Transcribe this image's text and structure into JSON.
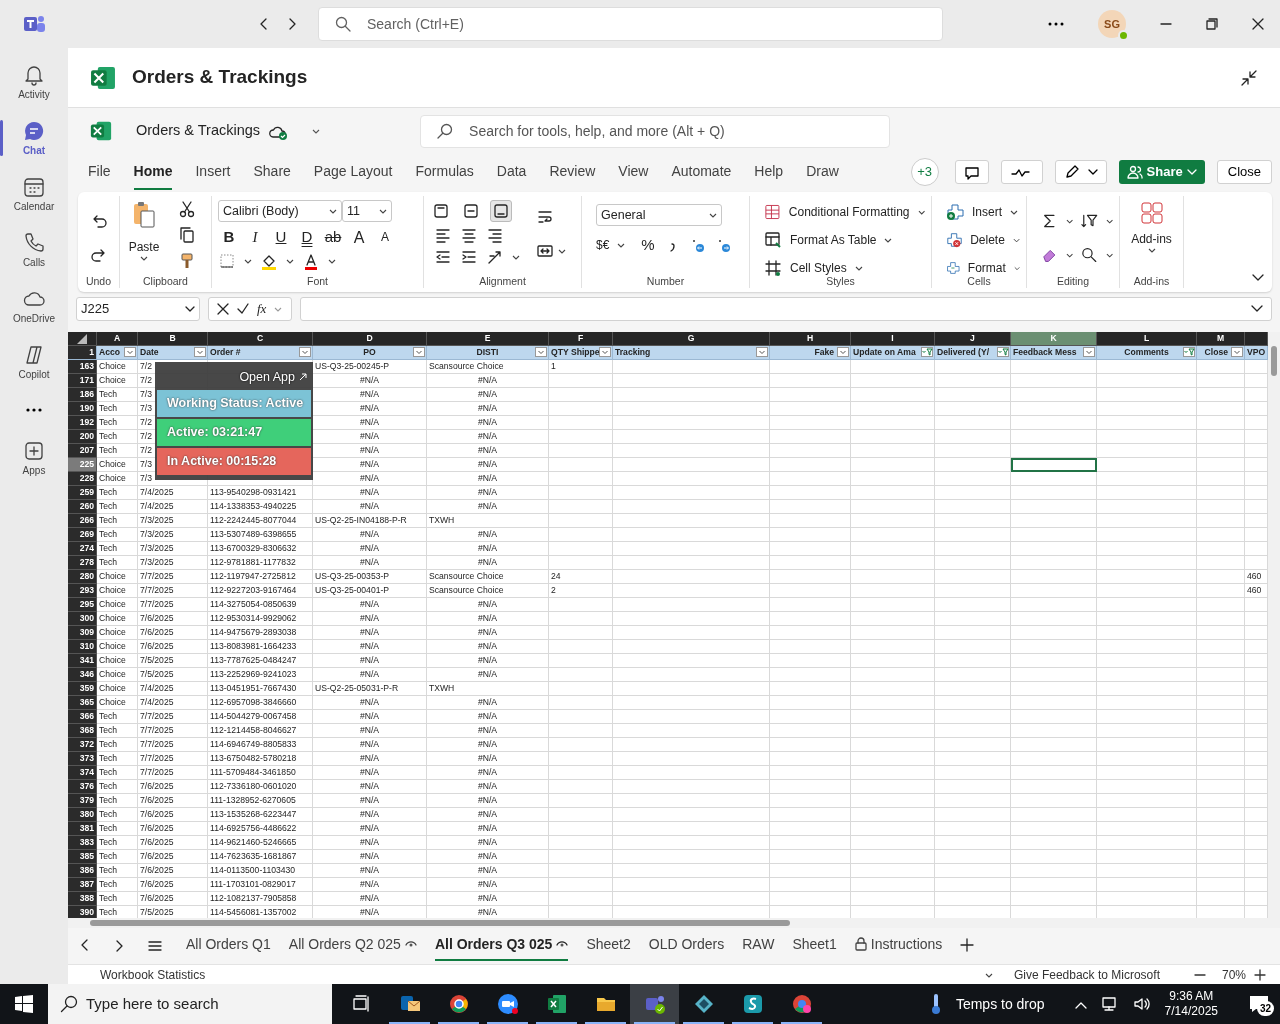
{
  "top_bar": {
    "search": {
      "placeholder": "Search (Ctrl+E)"
    },
    "avatar": "SG",
    "online": true
  },
  "rail": [
    {
      "label": "Activity",
      "selected": false
    },
    {
      "label": "Chat",
      "selected": true
    },
    {
      "label": "Calendar",
      "selected": false
    },
    {
      "label": "Calls",
      "selected": false
    },
    {
      "label": "OneDrive",
      "selected": false
    },
    {
      "label": "Copilot",
      "selected": false
    },
    {
      "label": "Apps",
      "selected": false
    }
  ],
  "app_header": {
    "title": "Orders & Trackings"
  },
  "workbook": {
    "title": "Orders & Trackings",
    "search": {
      "placeholder": "Search for tools, help, and more (Alt + Q)"
    }
  },
  "menu_tabs": [
    {
      "label": "File",
      "selected": false
    },
    {
      "label": "Home",
      "selected": true
    },
    {
      "label": "Insert",
      "selected": false
    },
    {
      "label": "Share",
      "selected": false
    },
    {
      "label": "Page Layout",
      "selected": false
    },
    {
      "label": "Formulas",
      "selected": false
    },
    {
      "label": "Data",
      "selected": false
    },
    {
      "label": "Review",
      "selected": false
    },
    {
      "label": "View",
      "selected": false
    },
    {
      "label": "Automate",
      "selected": false
    },
    {
      "label": "Help",
      "selected": false
    },
    {
      "label": "Draw",
      "selected": false
    }
  ],
  "collaborators": "+3",
  "share_button": "Share",
  "close_button": "Close",
  "ribbon": {
    "undo_label": "Undo",
    "paste": "Paste",
    "clipboard_label": "Clipboard",
    "font_name": "Calibri (Body)",
    "font_size": "11",
    "font_buttons": [
      {
        "label": "B",
        "kind": "bold"
      },
      {
        "label": "I",
        "kind": "italic"
      },
      {
        "label": "U",
        "kind": "underline"
      },
      {
        "label": "D",
        "kind": "double"
      },
      {
        "label": "ab",
        "kind": "strike"
      },
      {
        "label": "A",
        "kind": "grow"
      },
      {
        "label": "A",
        "kind": "shrink"
      }
    ],
    "font_label": "Font",
    "vertical_align": [
      {
        "selected": false
      },
      {
        "selected": false
      },
      {
        "selected": true
      }
    ],
    "alignment_label": "Alignment",
    "number_format": "General",
    "currency": "$€",
    "percent": "%",
    "number_label": "Number",
    "styles": [
      "Conditional Formatting",
      "Format As Table",
      "Cell Styles"
    ],
    "styles_label": "Styles",
    "cells": [
      "Insert",
      "Delete",
      "Format"
    ],
    "cells_label": "Cells",
    "editing_label": "Editing",
    "addins": "Add-ins",
    "addins_label": "Add-ins"
  },
  "formula_bar": {
    "name_box": "J225",
    "fx": "fx"
  },
  "grid": {
    "header_row_number": "1",
    "columns": [
      {
        "letter": "A",
        "header": "Acco",
        "filtered": false,
        "selected": false
      },
      {
        "letter": "B",
        "header": "Date",
        "filtered": false,
        "selected": false
      },
      {
        "letter": "C",
        "header": "Order #",
        "filtered": false,
        "selected": false
      },
      {
        "letter": "D",
        "header": "PO",
        "filtered": false,
        "selected": false
      },
      {
        "letter": "E",
        "header": "DISTI",
        "filtered": false,
        "selected": false
      },
      {
        "letter": "F",
        "header": "QTY Shippe",
        "filtered": false,
        "selected": false
      },
      {
        "letter": "G",
        "header": "Tracking",
        "filtered": false,
        "selected": false
      },
      {
        "letter": "H",
        "header": "Fake",
        "filtered": false,
        "selected": false
      },
      {
        "letter": "I",
        "header": "Update on Ama",
        "filtered": true,
        "selected": false
      },
      {
        "letter": "J",
        "header": "Delivered (Y/",
        "filtered": true,
        "selected": false
      },
      {
        "letter": "K",
        "header": "Feedback Mess",
        "filtered": false,
        "selected": true
      },
      {
        "letter": "L",
        "header": "Comments",
        "filtered": true,
        "selected": false
      },
      {
        "letter": "M",
        "header": "Close",
        "filtered": false,
        "selected": false
      },
      {
        "header": "VPO"
      }
    ],
    "rows": [
      {
        "n": "163",
        "kind": "match",
        "selected": false,
        "account": "Choice",
        "date": "7/2",
        "po": "US-Q3-25-00245-P",
        "disti": "Scansource Choice",
        "qty": "1"
      },
      {
        "n": "171",
        "kind": "na",
        "selected": false,
        "account": "Choice",
        "date": "7/2",
        "po": "#N/A",
        "disti": "#N/A"
      },
      {
        "n": "186",
        "kind": "na",
        "selected": false,
        "account": "Tech",
        "date": "7/3",
        "po": "#N/A",
        "disti": "#N/A"
      },
      {
        "n": "190",
        "kind": "na",
        "selected": false,
        "account": "Tech",
        "date": "7/3",
        "po": "#N/A",
        "disti": "#N/A"
      },
      {
        "n": "192",
        "kind": "na",
        "selected": false,
        "account": "Tech",
        "date": "7/2",
        "po": "#N/A",
        "disti": "#N/A"
      },
      {
        "n": "200",
        "kind": "na",
        "selected": false,
        "account": "Tech",
        "date": "7/2",
        "po": "#N/A",
        "disti": "#N/A"
      },
      {
        "n": "207",
        "kind": "na",
        "selected": false,
        "account": "Tech",
        "date": "7/2",
        "po": "#N/A",
        "disti": "#N/A"
      },
      {
        "n": "225",
        "kind": "na",
        "selected": true,
        "account": "Choice",
        "date": "7/3",
        "po": "#N/A",
        "disti": "#N/A"
      },
      {
        "n": "228",
        "kind": "na",
        "selected": false,
        "account": "Choice",
        "date": "7/3",
        "po": "#N/A",
        "disti": "#N/A"
      },
      {
        "n": "259",
        "kind": "na",
        "selected": false,
        "account": "Tech",
        "date": "7/4/2025",
        "order": "113-9540298-0931421",
        "po": "#N/A",
        "disti": "#N/A"
      },
      {
        "n": "260",
        "kind": "na",
        "selected": false,
        "account": "Tech",
        "date": "7/4/2025",
        "order": "114-1338353-4940225",
        "po": "#N/A",
        "disti": "#N/A"
      },
      {
        "n": "266",
        "kind": "match",
        "selected": false,
        "account": "Tech",
        "date": "7/3/2025",
        "order": "112-2242445-8077044",
        "po": "US-Q2-25-IN04188-P-R",
        "disti": "TXWH"
      },
      {
        "n": "269",
        "kind": "na",
        "selected": false,
        "account": "Tech",
        "date": "7/3/2025",
        "order": "113-5307489-6398655",
        "po": "#N/A",
        "disti": "#N/A"
      },
      {
        "n": "274",
        "kind": "na",
        "selected": false,
        "account": "Tech",
        "date": "7/3/2025",
        "order": "113-6700329-8306632",
        "po": "#N/A",
        "disti": "#N/A"
      },
      {
        "n": "278",
        "kind": "na",
        "selected": false,
        "account": "Tech",
        "date": "7/3/2025",
        "order": "112-9781881-1177832",
        "po": "#N/A",
        "disti": "#N/A"
      },
      {
        "n": "280",
        "kind": "match",
        "selected": false,
        "account": "Choice",
        "date": "7/7/2025",
        "order": "112-1197947-2725812",
        "po": "US-Q3-25-00353-P",
        "disti": "Scansource Choice",
        "qty": "24",
        "vpo": "460"
      },
      {
        "n": "293",
        "kind": "match",
        "selected": false,
        "account": "Choice",
        "date": "7/7/2025",
        "order": "112-9227203-9167464",
        "po": "US-Q3-25-00401-P",
        "disti": "Scansource Choice",
        "qty": "2",
        "vpo": "460"
      },
      {
        "n": "295",
        "kind": "na",
        "selected": false,
        "account": "Choice",
        "date": "7/7/2025",
        "order": "114-3275054-0850639",
        "po": "#N/A",
        "disti": "#N/A"
      },
      {
        "n": "300",
        "kind": "na",
        "selected": false,
        "account": "Choice",
        "date": "7/6/2025",
        "order": "112-9530314-9929062",
        "po": "#N/A",
        "disti": "#N/A"
      },
      {
        "n": "309",
        "kind": "na",
        "selected": false,
        "account": "Choice",
        "date": "7/6/2025",
        "order": "114-9475679-2893038",
        "po": "#N/A",
        "disti": "#N/A"
      },
      {
        "n": "310",
        "kind": "na",
        "selected": false,
        "account": "Choice",
        "date": "7/6/2025",
        "order": "113-8083981-1664233",
        "po": "#N/A",
        "disti": "#N/A"
      },
      {
        "n": "341",
        "kind": "na",
        "selected": false,
        "account": "Choice",
        "date": "7/5/2025",
        "order": "113-7787625-0484247",
        "po": "#N/A",
        "disti": "#N/A"
      },
      {
        "n": "346",
        "kind": "na",
        "selected": false,
        "account": "Choice",
        "date": "7/5/2025",
        "order": "113-2252969-9241023",
        "po": "#N/A",
        "disti": "#N/A"
      },
      {
        "n": "359",
        "kind": "match",
        "selected": false,
        "account": "Choice",
        "date": "7/4/2025",
        "order": "113-0451951-7667430",
        "po": "US-Q2-25-05031-P-R",
        "disti": "TXWH"
      },
      {
        "n": "365",
        "kind": "na",
        "selected": false,
        "account": "Choice",
        "date": "7/4/2025",
        "order": "112-6957098-3846660",
        "po": "#N/A",
        "disti": "#N/A"
      },
      {
        "n": "366",
        "kind": "na",
        "selected": false,
        "account": "Tech",
        "date": "7/7/2025",
        "order": "114-5044279-0067458",
        "po": "#N/A",
        "disti": "#N/A"
      },
      {
        "n": "368",
        "kind": "na",
        "selected": false,
        "account": "Tech",
        "date": "7/7/2025",
        "order": "112-1214458-8046627",
        "po": "#N/A",
        "disti": "#N/A"
      },
      {
        "n": "372",
        "kind": "na",
        "selected": false,
        "account": "Tech",
        "date": "7/7/2025",
        "order": "114-6946749-8805833",
        "po": "#N/A",
        "disti": "#N/A"
      },
      {
        "n": "373",
        "kind": "na",
        "selected": false,
        "account": "Tech",
        "date": "7/7/2025",
        "order": "113-6750482-5780218",
        "po": "#N/A",
        "disti": "#N/A"
      },
      {
        "n": "374",
        "kind": "na",
        "selected": false,
        "account": "Tech",
        "date": "7/7/2025",
        "order": "111-5709484-3461850",
        "po": "#N/A",
        "disti": "#N/A"
      },
      {
        "n": "376",
        "kind": "na",
        "selected": false,
        "account": "Tech",
        "date": "7/6/2025",
        "order": "112-7336180-0601020",
        "po": "#N/A",
        "disti": "#N/A"
      },
      {
        "n": "379",
        "kind": "na",
        "selected": false,
        "account": "Tech",
        "date": "7/6/2025",
        "order": "111-1328952-6270605",
        "po": "#N/A",
        "disti": "#N/A"
      },
      {
        "n": "380",
        "kind": "na",
        "selected": false,
        "account": "Tech",
        "date": "7/6/2025",
        "order": "113-1535268-6223447",
        "po": "#N/A",
        "disti": "#N/A"
      },
      {
        "n": "381",
        "kind": "na",
        "selected": false,
        "account": "Tech",
        "date": "7/6/2025",
        "order": "114-6925756-4486622",
        "po": "#N/A",
        "disti": "#N/A"
      },
      {
        "n": "383",
        "kind": "na",
        "selected": false,
        "account": "Tech",
        "date": "7/6/2025",
        "order": "114-9621460-5246665",
        "po": "#N/A",
        "disti": "#N/A"
      },
      {
        "n": "385",
        "kind": "na",
        "selected": false,
        "account": "Tech",
        "date": "7/6/2025",
        "order": "114-7623635-1681867",
        "po": "#N/A",
        "disti": "#N/A"
      },
      {
        "n": "386",
        "kind": "na",
        "selected": false,
        "account": "Tech",
        "date": "7/6/2025",
        "order": "114-0113500-1103430",
        "po": "#N/A",
        "disti": "#N/A"
      },
      {
        "n": "387",
        "kind": "na",
        "selected": false,
        "account": "Tech",
        "date": "7/6/2025",
        "order": "111-1703101-0829017",
        "po": "#N/A",
        "disti": "#N/A"
      },
      {
        "n": "388",
        "kind": "na",
        "selected": false,
        "account": "Tech",
        "date": "7/6/2025",
        "order": "112-1082137-7905858",
        "po": "#N/A",
        "disti": "#N/A"
      },
      {
        "n": "390",
        "kind": "na",
        "selected": false,
        "account": "Tech",
        "date": "7/5/2025",
        "order": "114-5456081-1357002",
        "po": "#N/A",
        "disti": "#N/A"
      }
    ]
  },
  "overlay": {
    "link": "Open App",
    "status": "Working Status: Active",
    "active": "Active: 03:21:47",
    "inactive": "In Active: 00:15:28"
  },
  "sheet_tabs": [
    {
      "label": "All Orders Q1",
      "selected": false,
      "kind": "plain"
    },
    {
      "label": "All Orders Q2 025",
      "selected": false,
      "kind": "watched"
    },
    {
      "label": "All Orders Q3 025",
      "selected": true,
      "kind": "watched"
    },
    {
      "label": "Sheet2",
      "selected": false,
      "kind": "plain"
    },
    {
      "label": "OLD Orders",
      "selected": false,
      "kind": "plain"
    },
    {
      "label": "RAW",
      "selected": false,
      "kind": "plain"
    },
    {
      "label": "Sheet1",
      "selected": false,
      "kind": "plain"
    },
    {
      "label": "Instructions",
      "selected": false,
      "kind": "locked"
    }
  ],
  "status_bar": {
    "left": "Workbook Statistics",
    "feedback": "Give Feedback to Microsoft",
    "zoom": "70%"
  },
  "taskbar": {
    "search": {
      "placeholder": "Type here to search"
    },
    "weather": "Temps to drop",
    "time": "9:36 AM",
    "date": "7/14/2025",
    "notifications": "32",
    "apps": [
      {
        "selected": false
      },
      {
        "selected": false
      },
      {
        "selected": false
      },
      {
        "selected": false
      },
      {
        "selected": false
      },
      {
        "selected": true
      },
      {
        "selected": false
      },
      {
        "selected": false
      },
      {
        "selected": false
      }
    ]
  }
}
